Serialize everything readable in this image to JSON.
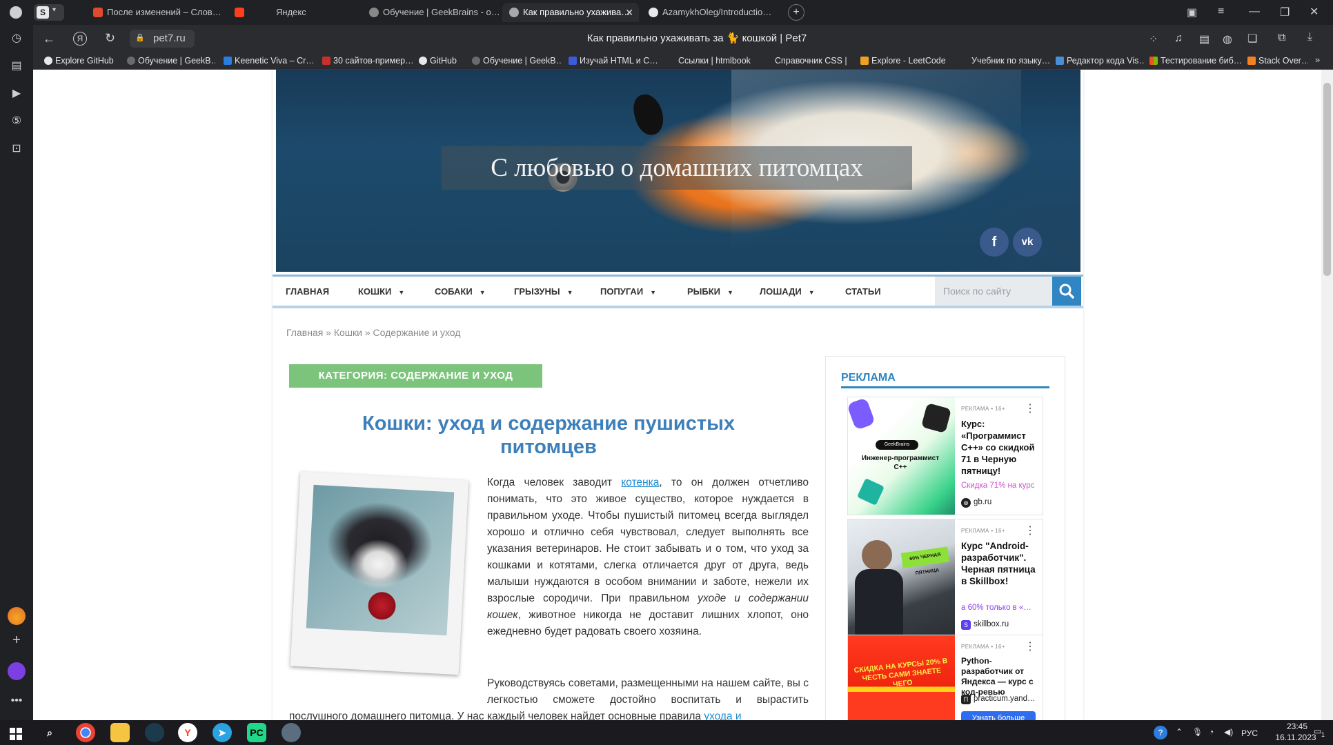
{
  "tabs": [
    {
      "label": "S",
      "icon": "s-badge-icon"
    },
    {
      "label": "После изменений – Слов…",
      "icon": "word-icon"
    },
    {
      "label": "Яндекс",
      "icon": "yandex-icon"
    },
    {
      "label": "Обучение | GeekBrains - о…",
      "icon": "geekbrains-icon"
    },
    {
      "label": "Как правильно ухажива…",
      "icon": "pet7-icon"
    },
    {
      "label": "AzamykhOleg/Introductio…",
      "icon": "github-icon"
    }
  ],
  "address": {
    "url": "pet7.ru",
    "page_title": "Как правильно ухаживать за 🐈 кошкой | Pet7"
  },
  "bookmarks": [
    "Explore GitHub",
    "Обучение | GeekB…",
    "Keenetic Viva – Cr…",
    "30 сайтов-пример…",
    "GitHub",
    "Обучение | GeekB…",
    "Изучай HTML и C…",
    "Ссылки | htmlbook",
    "Справочник CSS |",
    "Explore - LeetCode",
    "Учебник по языку…",
    "Редактор кода Vis…",
    "Тестирование биб…",
    "Stack Over…"
  ],
  "site": {
    "banner_title": "С любовью о домашних питомцах",
    "social": [
      "f",
      "vk"
    ],
    "nav": [
      "ГЛАВНАЯ",
      "КОШКИ",
      "СОБАКИ",
      "ГРЫЗУНЫ",
      "ПОПУГАИ",
      "РЫБКИ",
      "ЛОШАДИ",
      "СТАТЬИ"
    ],
    "search_placeholder": "Поиск по сайту",
    "breadcrumb": "Главная » Кошки » Содержание и уход",
    "category_label": "КАТЕГОРИЯ: СОДЕРЖАНИЕ И УХОД",
    "post_title": "Кошки: уход и содержание пушистых питомцев",
    "para1_a": "Когда человек заводит ",
    "para1_link": "котенка",
    "para1_b": ", то он должен отчетливо понимать, что это живое существо, которое нуждается в правильном уходе. Чтобы пушистый питомец всегда выглядел хорошо и отлично себя чувствовал, следует выполнять все указания ветеринаров. Не стоит забывать и о том, что уход за кошками и котятами, слегка отличается друг от друга, ведь малыши нуждаются в особом внимании и заботе, нежели их взрослые сородичи. При правильном ",
    "para1_italic": "уходе и содержании кошек",
    "para1_c": ", животное никогда не доставит лишних хлопот, оно ежедневно будет радовать своего хозяина.",
    "para2_a": "Руководствуясь советами, размещенными на нашем сайте, вы с легкостью сможете достойно воспитать и вырастить послушного домашнего питомца. У нас каждый человек найдет основные правила ",
    "para2_link": "ухода и"
  },
  "sidebar": {
    "title": "РЕКЛАМА",
    "ads": [
      {
        "meta": "РЕКЛАМА • 16+",
        "title": "Курс: «Программист С++» со скидкой 71 в Черную пятницу!",
        "promo": "Скидка 71% на курс",
        "domain": "gb.ru",
        "image_text": "Инженер-программист С++",
        "image_brand": "GeekBrains",
        "promo_color": "#d24fd2"
      },
      {
        "meta": "РЕКЛАМА • 16+",
        "title": "Курс \"Android-разработчик\". Черная пятница в Skillbox!",
        "promo": "а 60% только в «…",
        "domain": "skillbox.ru",
        "image_text": "60% ЧЕРНАЯ ПЯТНИЦА",
        "promo_color": "#8a3ff0"
      },
      {
        "meta": "РЕКЛАМА • 16+",
        "title": "Python-разработчик от Яндекса — курс с код-ревью",
        "promo": "Узнать больше",
        "domain": "practicum.yand…",
        "image_text": "СКИДКА НА КУРСЫ 20% В ЧЕСТЬ САМИ ЗНАЕТЕ ЧЕГО",
        "promo_color": "#2f6df0"
      }
    ]
  },
  "taskbar": {
    "tray_lang": "РУС",
    "time": "23:45",
    "date": "16.11.2023",
    "notifications": "1"
  },
  "colors": {
    "accent": "#3d7fba",
    "category_green": "#7cc47c",
    "nav_border": "#8fb8d8",
    "search_button": "#2f86c2"
  }
}
